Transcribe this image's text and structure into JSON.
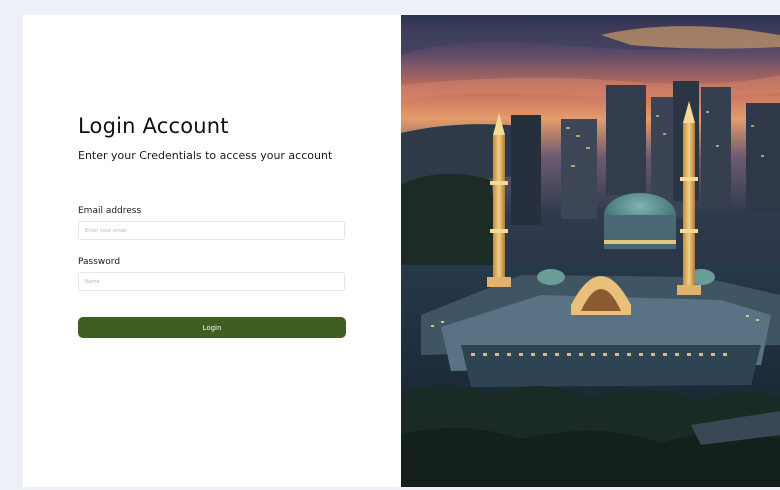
{
  "login": {
    "title": "Login Account",
    "subtitle": "Enter your Credentials to access your account",
    "email_label": "Email address",
    "email_placeholder": "Enter your email",
    "password_label": "Password",
    "password_placeholder": "Name",
    "login_button": "Login"
  },
  "colors": {
    "page_background": "#eef0f8",
    "button_green": "#3f5e22"
  },
  "icons": [
    "mosque-photo"
  ]
}
